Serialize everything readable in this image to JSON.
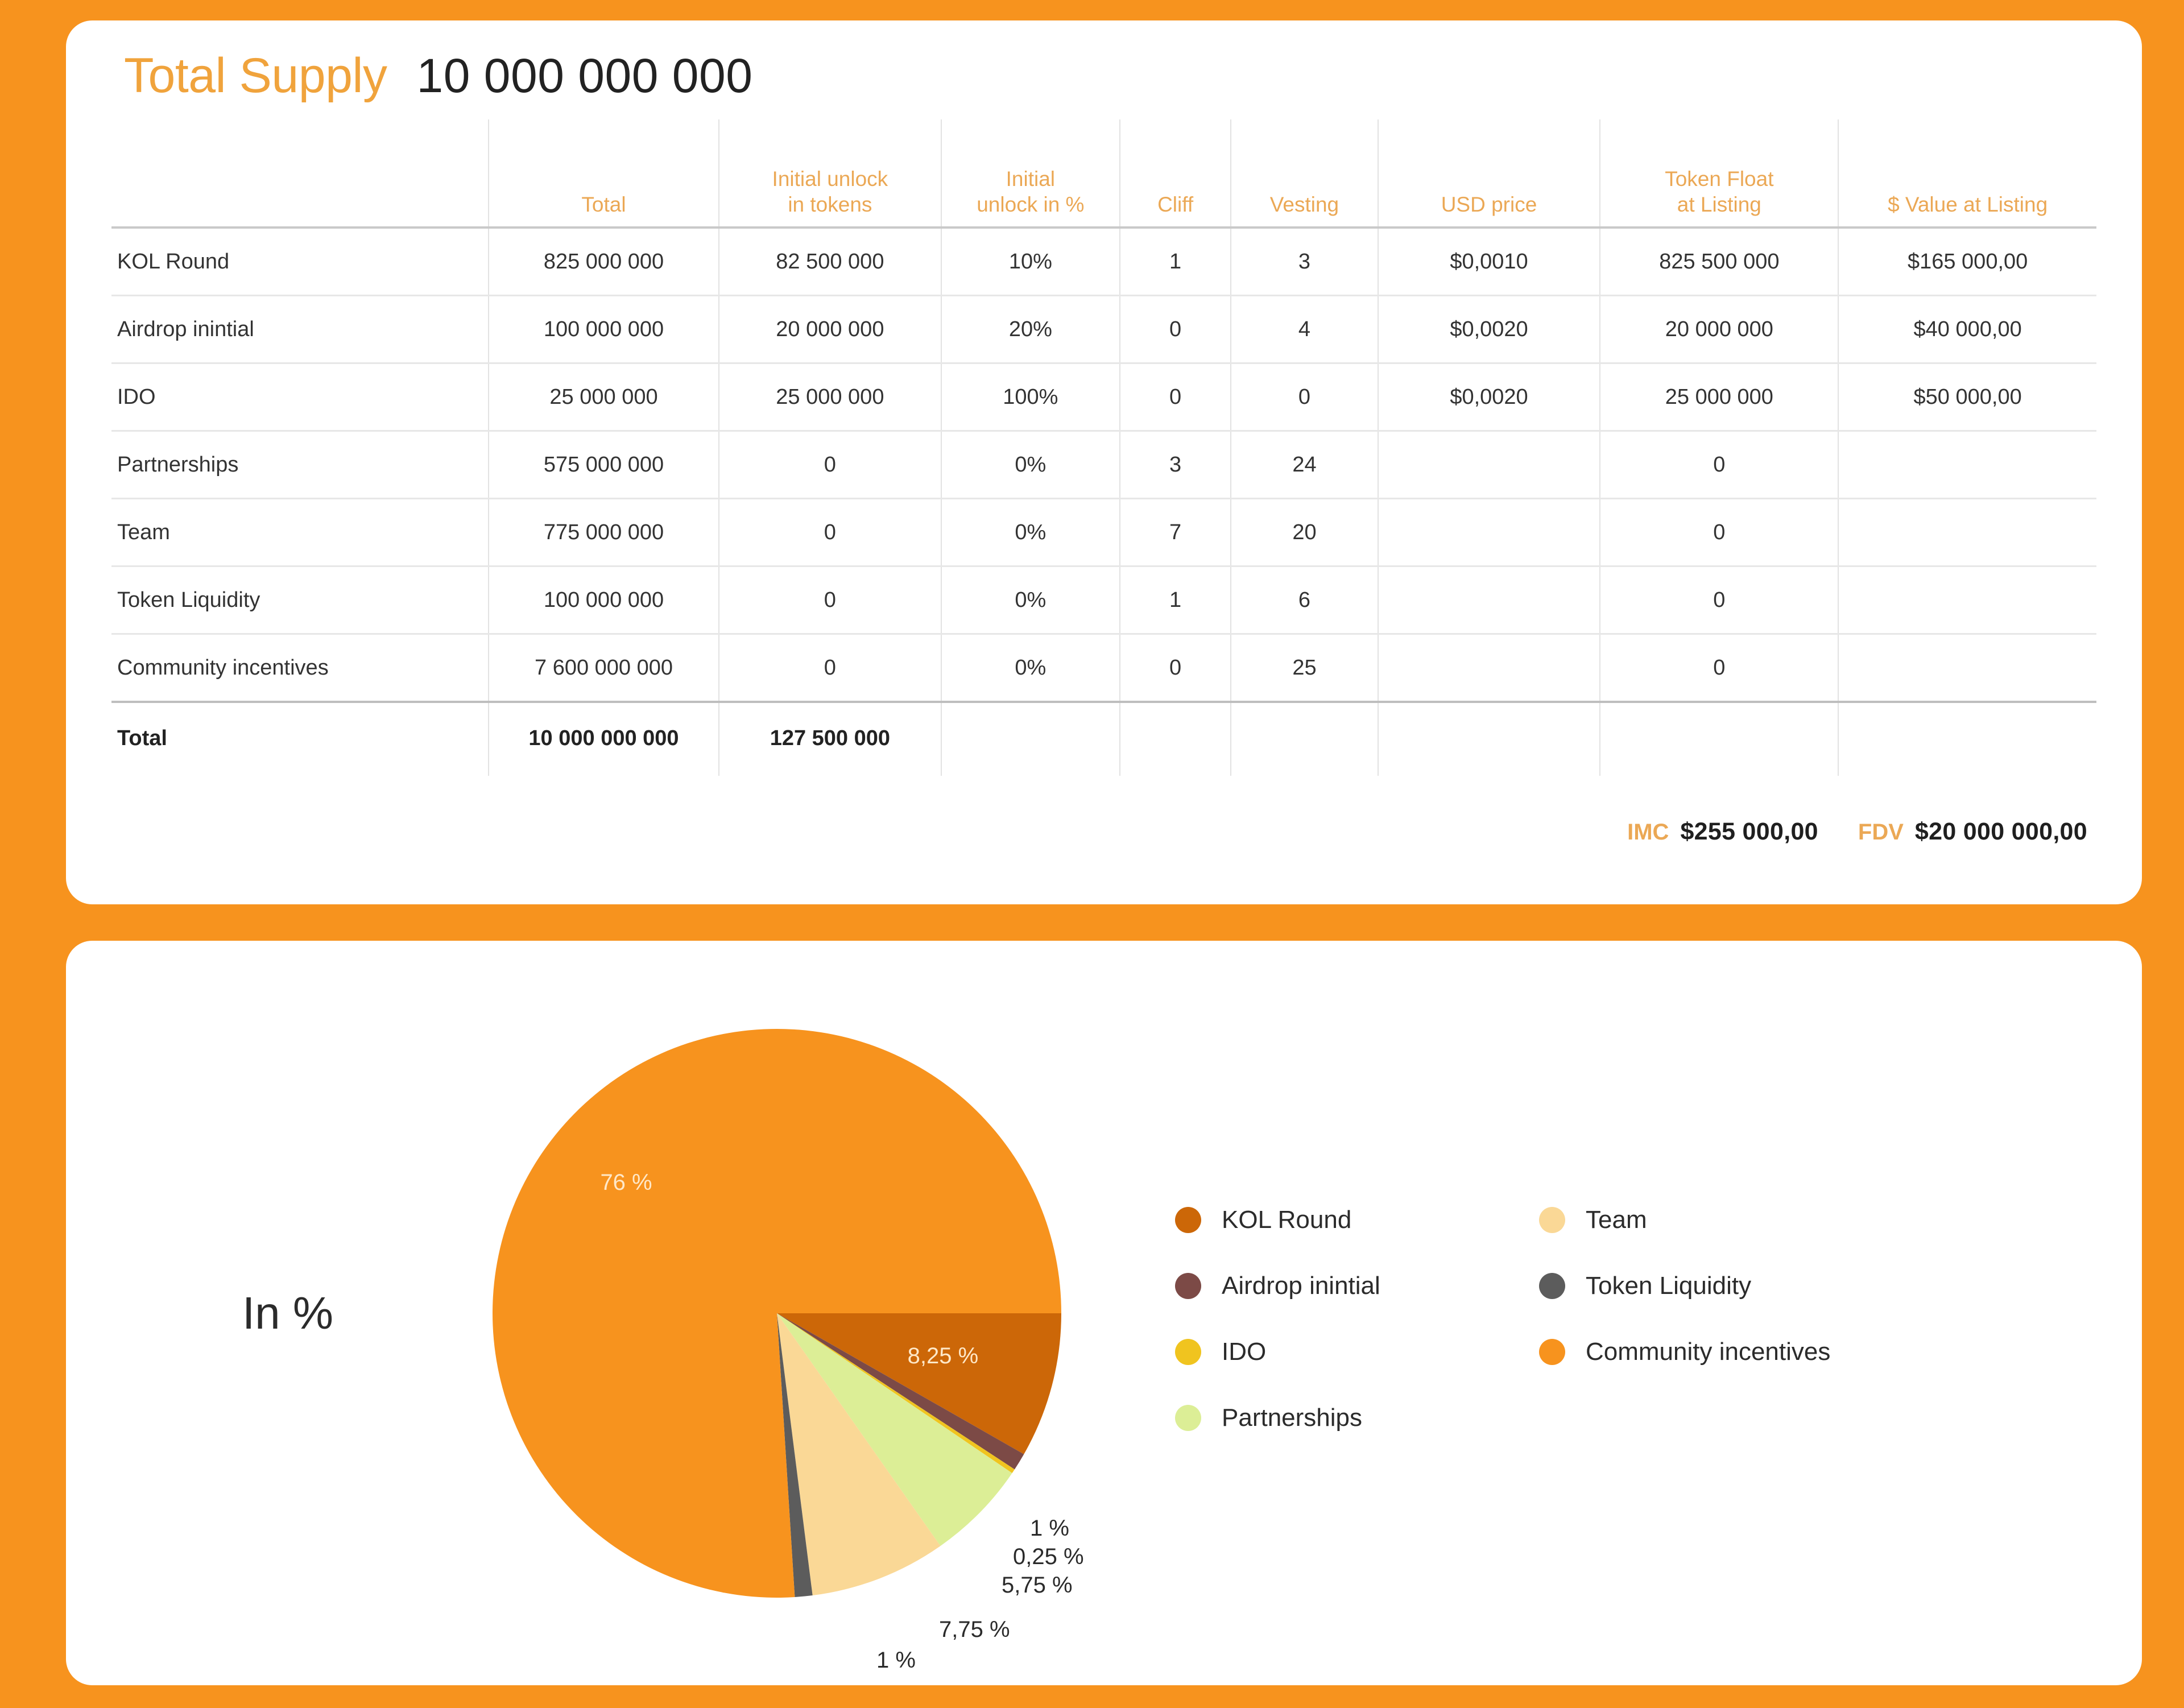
{
  "background_color": "#F7931E",
  "supply": {
    "title": "Total Supply",
    "value": "10 000 000 000"
  },
  "table": {
    "headers": {
      "name": "",
      "total": "Total",
      "initial_unlock_tokens_l1": "Initial unlock",
      "initial_unlock_tokens_l2": "in tokens",
      "initial_unlock_pct_l1": "Initial",
      "initial_unlock_pct_l2": "unlock in %",
      "cliff": "Cliff",
      "vesting": "Vesting",
      "usd_price": "USD price",
      "token_float_l1": "Token Float",
      "token_float_l2": "at Listing",
      "value_at_listing": "$ Value at Listing"
    },
    "rows": [
      {
        "name": "KOL Round",
        "total": "825 000 000",
        "unlock_tokens": "82 500 000",
        "unlock_pct": "10%",
        "cliff": "1",
        "vesting": "3",
        "usd_price": "$0,0010",
        "token_float": "825 500 000",
        "value_listing": "$165 000,00"
      },
      {
        "name": "Airdrop inintial",
        "total": "100 000 000",
        "unlock_tokens": "20 000 000",
        "unlock_pct": "20%",
        "cliff": "0",
        "vesting": "4",
        "usd_price": "$0,0020",
        "token_float": "20 000 000",
        "value_listing": "$40 000,00"
      },
      {
        "name": "IDO",
        "total": "25 000 000",
        "unlock_tokens": "25 000 000",
        "unlock_pct": "100%",
        "cliff": "0",
        "vesting": "0",
        "usd_price": "$0,0020",
        "token_float": "25 000 000",
        "value_listing": "$50 000,00"
      },
      {
        "name": "Partnerships",
        "total": "575 000 000",
        "unlock_tokens": "0",
        "unlock_pct": "0%",
        "cliff": "3",
        "vesting": "24",
        "usd_price": "",
        "token_float": "0",
        "value_listing": ""
      },
      {
        "name": "Team",
        "total": "775 000 000",
        "unlock_tokens": "0",
        "unlock_pct": "0%",
        "cliff": "7",
        "vesting": "20",
        "usd_price": "",
        "token_float": "0",
        "value_listing": ""
      },
      {
        "name": "Token Liquidity",
        "total": "100 000 000",
        "unlock_tokens": "0",
        "unlock_pct": "0%",
        "cliff": "1",
        "vesting": "6",
        "usd_price": "",
        "token_float": "0",
        "value_listing": ""
      },
      {
        "name": "Community incentives",
        "total": "7 600 000 000",
        "unlock_tokens": "0",
        "unlock_pct": "0%",
        "cliff": "0",
        "vesting": "25",
        "usd_price": "",
        "token_float": "0",
        "value_listing": ""
      }
    ],
    "total_row": {
      "name": "Total",
      "total": "10 000 000 000",
      "unlock_tokens": "127 500 000",
      "unlock_pct": "",
      "cliff": "",
      "vesting": "",
      "usd_price": "",
      "token_float": "",
      "value_listing": ""
    }
  },
  "metrics": [
    {
      "label": "IMC",
      "value": "$255 000,00"
    },
    {
      "label": "FDV",
      "value": "$20 000 000,00"
    }
  ],
  "chart_section": {
    "caption": "In %"
  },
  "chart_data": {
    "type": "pie",
    "title": "In %",
    "unit": "%",
    "legend_position": "right",
    "categories": [
      "KOL Round",
      "Airdrop inintial",
      "IDO",
      "Partnerships",
      "Team",
      "Token Liquidity",
      "Community incentives"
    ],
    "values": [
      8.25,
      1,
      0.25,
      5.75,
      7.75,
      1,
      76
    ],
    "labels": [
      "8,25 %",
      "1 %",
      "0,25 %",
      "5,75 %",
      "7,75 %",
      "1 %",
      "76 %"
    ],
    "colors": [
      "#CC6708",
      "#7C4A46",
      "#F0C41F",
      "#DCEE96",
      "#FAD896",
      "#5C5C5C",
      "#F7931E"
    ],
    "start_angle_deg": 0,
    "direction": "clockwise"
  },
  "legend": {
    "column_1": [
      {
        "label": "KOL Round",
        "color": "#CC6708"
      },
      {
        "label": "Airdrop inintial",
        "color": "#7C4A46"
      },
      {
        "label": "IDO",
        "color": "#F0C41F"
      },
      {
        "label": "Partnerships",
        "color": "#DCEE96"
      }
    ],
    "column_2": [
      {
        "label": "Team",
        "color": "#FAD896"
      },
      {
        "label": "Token Liquidity",
        "color": "#5C5C5C"
      },
      {
        "label": "Community incentives",
        "color": "#F7931E"
      }
    ]
  }
}
